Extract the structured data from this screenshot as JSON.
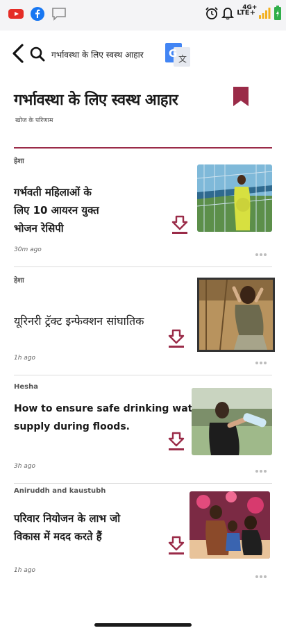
{
  "status_bar": {
    "network_label": "LTE+",
    "network_generation": "4G+",
    "icons": [
      "youtube-icon",
      "facebook-icon",
      "message-icon",
      "alarm-icon",
      "bell-icon",
      "signal-icon",
      "battery-icon"
    ]
  },
  "top_bar": {
    "search_text": "गर्भावस्था के लिए स्वस्थ आहार",
    "icons": [
      "back-arrow-icon",
      "search-icon",
      "translate-icon"
    ]
  },
  "header": {
    "title": "गर्भावस्था के लिए स्वस्थ आहार",
    "subtitle": "खोज के परिणाम"
  },
  "articles": [
    {
      "author": "हेशा",
      "headline_lines": [
        "गर्भवती महिलाओं के",
        "लिए 10 आयरन युक्त",
        "भोजन रेसिपी"
      ],
      "time": "30m ago"
    },
    {
      "author": "हेशा",
      "headline_lines": [
        "यूरिनरी ट्रॅक्ट इन्फेक्शन सांघातिक"
      ],
      "time": "1h ago"
    },
    {
      "author": "Hesha",
      "headline_lines": [
        "How to ensure safe drinking water",
        "supply during floods."
      ],
      "time": "3h ago"
    },
    {
      "author": "Aniruddh and kaustubh",
      "headline_lines": [
        "परिवार नियोजन के लाभ जो",
        "विकास में मदद करते हैं"
      ],
      "time": "1h ago"
    }
  ],
  "colors": {
    "accent": "#9a2b48",
    "status_bar_bg": "#f4f4f6"
  }
}
